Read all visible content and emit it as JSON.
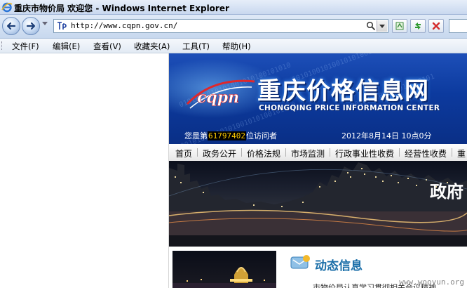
{
  "window": {
    "title": "重庆市物价局 欢迎您 - Windows Internet Explorer"
  },
  "address_bar": {
    "url": "http://www.cqpn.gov.cn/"
  },
  "menu": {
    "items": [
      "文件(F)",
      "编辑(E)",
      "查看(V)",
      "收藏夹(A)",
      "工具(T)",
      "帮助(H)"
    ]
  },
  "banner": {
    "site_name": "重庆价格信息网",
    "site_name_en": "CHONGQING PRICE INFORMATION CENTER",
    "logo_text": "cqpn",
    "visitor_prefix": "您是第",
    "visitor_count": "61797402",
    "visitor_suffix": "位访问者",
    "datetime": "2012年8月14日 10点0分"
  },
  "nav": {
    "items": [
      "首页",
      "政务公开",
      "价格法规",
      "市场监测",
      "行政事业性收费",
      "经营性收费",
      "重"
    ]
  },
  "photo": {
    "overlay_text": "政府"
  },
  "section": {
    "title": "动态信息",
    "news_first": "市物价局认真学习贯彻相关会议精神"
  },
  "watermark": "www.wooyun.org"
}
